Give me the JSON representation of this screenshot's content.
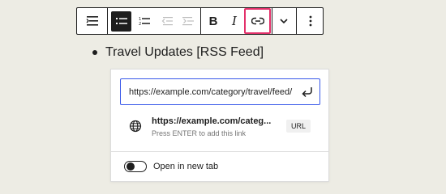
{
  "toolbar": {
    "items": [
      {
        "name": "Align",
        "icon": "align-icon"
      },
      {
        "name": "Unordered list",
        "icon": "unordered-list-icon",
        "active": true
      },
      {
        "name": "Ordered list",
        "icon": "ordered-list-icon"
      },
      {
        "name": "Outdent",
        "icon": "outdent-icon"
      },
      {
        "name": "Indent",
        "icon": "indent-icon"
      },
      {
        "name": "Bold",
        "icon": "bold-icon",
        "glyph": "B"
      },
      {
        "name": "Italic",
        "icon": "italic-icon",
        "glyph": "I"
      },
      {
        "name": "Link",
        "icon": "link-icon",
        "highlighted": true
      },
      {
        "name": "More",
        "icon": "chevron-down-icon"
      },
      {
        "name": "Options",
        "icon": "vertical-ellipsis-icon"
      }
    ],
    "highlight_color": "#e3306a"
  },
  "content": {
    "list_item": "Travel Updates [RSS Feed]"
  },
  "link_popover": {
    "input_value": "https://example.com/category/travel/feed/",
    "submit_icon": "enter-icon",
    "suggestion": {
      "icon": "globe-icon",
      "title": "https://example.com/categ...",
      "hint": "Press ENTER to add this link",
      "badge": "URL"
    },
    "toggle": {
      "label": "Open in new tab",
      "checked": false
    },
    "accent_color": "#3858e9"
  }
}
